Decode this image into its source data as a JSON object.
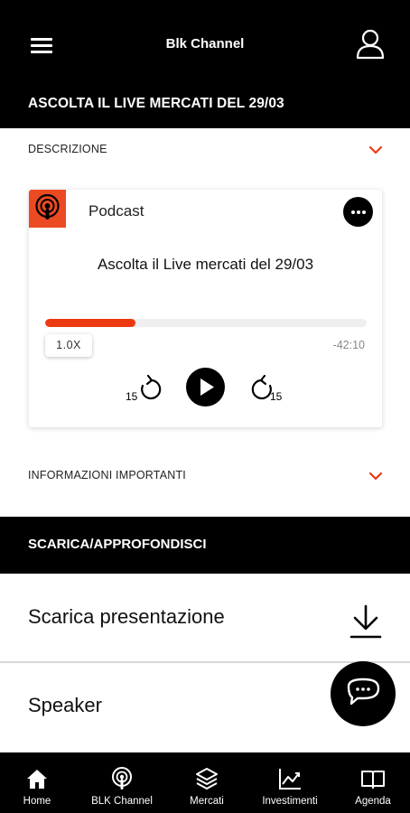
{
  "header": {
    "title": "Blk Channel"
  },
  "live_title": "ASCOLTA IL LIVE MERCATI DEL 29/03",
  "accordions": {
    "description": "DESCRIZIONE",
    "important_info": "INFORMAZIONI IMPORTANTI"
  },
  "player": {
    "source_label": "Podcast",
    "episode_title": "Ascolta il Live mercati del 29/03",
    "progress_fraction": 0.28,
    "speed": "1.0X",
    "remaining": "-42:10",
    "skip_back_seconds": "15",
    "skip_forward_seconds": "15"
  },
  "section_title": "SCARICA/APPROFONDISCI",
  "rows": [
    {
      "label": "Scarica presentazione"
    },
    {
      "label": "Speaker"
    }
  ],
  "tabs": [
    {
      "label": "Home",
      "icon": "home-icon"
    },
    {
      "label": "BLK Channel",
      "icon": "podcast-icon"
    },
    {
      "label": "Mercati",
      "icon": "layers-icon"
    },
    {
      "label": "Investimenti",
      "icon": "chart-icon"
    },
    {
      "label": "Agenda",
      "icon": "book-icon"
    }
  ],
  "colors": {
    "accent": "#ec3a13",
    "bar_bg": "#000000"
  }
}
